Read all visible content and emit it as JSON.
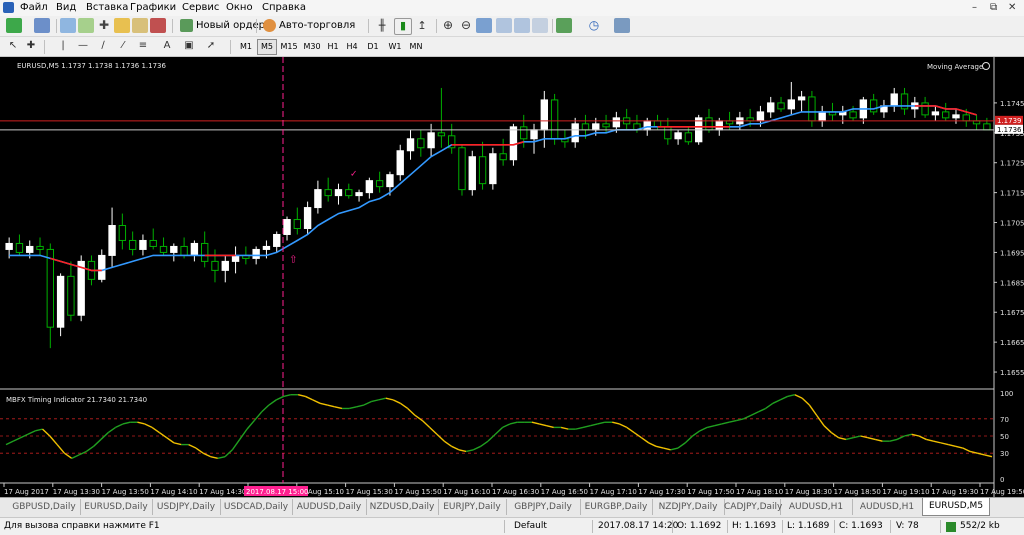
{
  "menu": [
    "Файл",
    "Вид",
    "Вставка",
    "Графики",
    "Сервис",
    "Окно",
    "Справка"
  ],
  "toolbar": {
    "new_order": "Новый ордер",
    "auto_trading": "Авто-торговля"
  },
  "timeframes": [
    "M1",
    "M5",
    "M15",
    "M30",
    "H1",
    "H4",
    "D1",
    "W1",
    "MN"
  ],
  "active_timeframe": "M5",
  "chart": {
    "header": "EURUSD,M5  1.1737 1.1738 1.1736 1.1736",
    "indicator_name": "Moving Average",
    "bid_label": "1.1736",
    "ask_label": "1.1739",
    "price_ticks": [
      "1.1745",
      "1.1735",
      "1.1725",
      "1.1715",
      "1.1705",
      "1.1695",
      "1.1685",
      "1.1675",
      "1.1665",
      "1.1655"
    ],
    "osc_header": "MBFX Timing Indicator 21.7340 21.7340",
    "osc_ticks": [
      "100",
      "70",
      "50",
      "30",
      "0"
    ],
    "time_ticks": [
      "17 Aug 2017",
      "17 Aug 13:30",
      "17 Aug 13:50",
      "17 Aug 14:10",
      "17 Aug 14:30",
      "2017.08.17 15:00",
      "17 Aug 15:10",
      "17 Aug 15:30",
      "17 Aug 15:50",
      "17 Aug 16:10",
      "17 Aug 16:30",
      "17 Aug 16:50",
      "17 Aug 17:10",
      "17 Aug 17:30",
      "17 Aug 17:50",
      "17 Aug 18:10",
      "17 Aug 18:30",
      "17 Aug 18:50",
      "17 Aug 19:10",
      "17 Aug 19:30",
      "17 Aug 19:50"
    ],
    "colors": {
      "bg": "#000000",
      "bull": "#ffffff",
      "bear": "#00b000",
      "ma_up": "#3399ff",
      "ma_down": "#ff2020",
      "osc_up": "#20a020",
      "osc_down": "#f0c000",
      "crosshair": "#ff2090"
    }
  },
  "chart_data": {
    "type": "candlestick",
    "symbol": "EURUSD",
    "timeframe": "M5",
    "ylim": [
      1.165,
      1.1755
    ],
    "candles": [
      {
        "o": 1.1696,
        "h": 1.17,
        "l": 1.1693,
        "c": 1.1698
      },
      {
        "o": 1.1698,
        "h": 1.1701,
        "l": 1.1694,
        "c": 1.1695
      },
      {
        "o": 1.1695,
        "h": 1.1699,
        "l": 1.1693,
        "c": 1.1697
      },
      {
        "o": 1.1697,
        "h": 1.17,
        "l": 1.1694,
        "c": 1.1696
      },
      {
        "o": 1.1696,
        "h": 1.1698,
        "l": 1.1663,
        "c": 1.167
      },
      {
        "o": 1.167,
        "h": 1.1688,
        "l": 1.1667,
        "c": 1.1687
      },
      {
        "o": 1.1687,
        "h": 1.1692,
        "l": 1.1672,
        "c": 1.1674
      },
      {
        "o": 1.1674,
        "h": 1.1694,
        "l": 1.1672,
        "c": 1.1692
      },
      {
        "o": 1.1692,
        "h": 1.1694,
        "l": 1.1684,
        "c": 1.1686
      },
      {
        "o": 1.1686,
        "h": 1.1696,
        "l": 1.1685,
        "c": 1.1694
      },
      {
        "o": 1.1694,
        "h": 1.171,
        "l": 1.169,
        "c": 1.1704
      },
      {
        "o": 1.1704,
        "h": 1.1708,
        "l": 1.1696,
        "c": 1.1699
      },
      {
        "o": 1.1699,
        "h": 1.1702,
        "l": 1.1694,
        "c": 1.1696
      },
      {
        "o": 1.1696,
        "h": 1.1701,
        "l": 1.1694,
        "c": 1.1699
      },
      {
        "o": 1.1699,
        "h": 1.1703,
        "l": 1.1696,
        "c": 1.1697
      },
      {
        "o": 1.1697,
        "h": 1.17,
        "l": 1.1694,
        "c": 1.1695
      },
      {
        "o": 1.1695,
        "h": 1.1698,
        "l": 1.1692,
        "c": 1.1697
      },
      {
        "o": 1.1697,
        "h": 1.17,
        "l": 1.1693,
        "c": 1.1694
      },
      {
        "o": 1.1694,
        "h": 1.1699,
        "l": 1.1692,
        "c": 1.1698
      },
      {
        "o": 1.1698,
        "h": 1.1702,
        "l": 1.169,
        "c": 1.1692
      },
      {
        "o": 1.1692,
        "h": 1.1696,
        "l": 1.1685,
        "c": 1.1689
      },
      {
        "o": 1.1689,
        "h": 1.1694,
        "l": 1.1685,
        "c": 1.1692
      },
      {
        "o": 1.1692,
        "h": 1.1697,
        "l": 1.1688,
        "c": 1.1694
      },
      {
        "o": 1.1694,
        "h": 1.1697,
        "l": 1.1691,
        "c": 1.1693
      },
      {
        "o": 1.1693,
        "h": 1.1697,
        "l": 1.1691,
        "c": 1.1696
      },
      {
        "o": 1.1696,
        "h": 1.1699,
        "l": 1.1693,
        "c": 1.1697
      },
      {
        "o": 1.1697,
        "h": 1.1702,
        "l": 1.1695,
        "c": 1.1701
      },
      {
        "o": 1.1701,
        "h": 1.1707,
        "l": 1.1699,
        "c": 1.1706
      },
      {
        "o": 1.1706,
        "h": 1.171,
        "l": 1.1701,
        "c": 1.1703
      },
      {
        "o": 1.1703,
        "h": 1.1712,
        "l": 1.1701,
        "c": 1.171
      },
      {
        "o": 1.171,
        "h": 1.1719,
        "l": 1.1708,
        "c": 1.1716
      },
      {
        "o": 1.1716,
        "h": 1.172,
        "l": 1.1712,
        "c": 1.1714
      },
      {
        "o": 1.1714,
        "h": 1.1718,
        "l": 1.1711,
        "c": 1.1716
      },
      {
        "o": 1.1716,
        "h": 1.1718,
        "l": 1.1713,
        "c": 1.1714
      },
      {
        "o": 1.1714,
        "h": 1.1716,
        "l": 1.1712,
        "c": 1.1715
      },
      {
        "o": 1.1715,
        "h": 1.172,
        "l": 1.1713,
        "c": 1.1719
      },
      {
        "o": 1.1719,
        "h": 1.1722,
        "l": 1.1715,
        "c": 1.1717
      },
      {
        "o": 1.1717,
        "h": 1.1722,
        "l": 1.1714,
        "c": 1.1721
      },
      {
        "o": 1.1721,
        "h": 1.1731,
        "l": 1.1719,
        "c": 1.1729
      },
      {
        "o": 1.1729,
        "h": 1.1736,
        "l": 1.1726,
        "c": 1.1733
      },
      {
        "o": 1.1733,
        "h": 1.1736,
        "l": 1.1727,
        "c": 1.173
      },
      {
        "o": 1.173,
        "h": 1.1738,
        "l": 1.1727,
        "c": 1.1735
      },
      {
        "o": 1.1735,
        "h": 1.175,
        "l": 1.173,
        "c": 1.1734
      },
      {
        "o": 1.1734,
        "h": 1.1738,
        "l": 1.1728,
        "c": 1.173
      },
      {
        "o": 1.173,
        "h": 1.1731,
        "l": 1.1714,
        "c": 1.1716
      },
      {
        "o": 1.1716,
        "h": 1.1729,
        "l": 1.1714,
        "c": 1.1727
      },
      {
        "o": 1.1727,
        "h": 1.1732,
        "l": 1.1716,
        "c": 1.1718
      },
      {
        "o": 1.1718,
        "h": 1.173,
        "l": 1.1716,
        "c": 1.1728
      },
      {
        "o": 1.1728,
        "h": 1.1733,
        "l": 1.1724,
        "c": 1.1726
      },
      {
        "o": 1.1726,
        "h": 1.1738,
        "l": 1.1724,
        "c": 1.1737
      },
      {
        "o": 1.1737,
        "h": 1.1741,
        "l": 1.173,
        "c": 1.1733
      },
      {
        "o": 1.1733,
        "h": 1.1738,
        "l": 1.1728,
        "c": 1.1736
      },
      {
        "o": 1.1736,
        "h": 1.1749,
        "l": 1.173,
        "c": 1.1746
      },
      {
        "o": 1.1746,
        "h": 1.1748,
        "l": 1.1731,
        "c": 1.1733
      },
      {
        "o": 1.1733,
        "h": 1.1736,
        "l": 1.173,
        "c": 1.1732
      },
      {
        "o": 1.1732,
        "h": 1.174,
        "l": 1.173,
        "c": 1.1738
      },
      {
        "o": 1.1738,
        "h": 1.1741,
        "l": 1.1733,
        "c": 1.1736
      },
      {
        "o": 1.1736,
        "h": 1.174,
        "l": 1.1734,
        "c": 1.1738
      },
      {
        "o": 1.1738,
        "h": 1.1741,
        "l": 1.1735,
        "c": 1.1737
      },
      {
        "o": 1.1737,
        "h": 1.1742,
        "l": 1.1735,
        "c": 1.174
      },
      {
        "o": 1.174,
        "h": 1.1743,
        "l": 1.1736,
        "c": 1.1738
      },
      {
        "o": 1.1738,
        "h": 1.1741,
        "l": 1.1735,
        "c": 1.1736
      },
      {
        "o": 1.1736,
        "h": 1.174,
        "l": 1.1734,
        "c": 1.1739
      },
      {
        "o": 1.1739,
        "h": 1.1741,
        "l": 1.1736,
        "c": 1.1737
      },
      {
        "o": 1.1737,
        "h": 1.174,
        "l": 1.1731,
        "c": 1.1733
      },
      {
        "o": 1.1733,
        "h": 1.1736,
        "l": 1.1731,
        "c": 1.1735
      },
      {
        "o": 1.1735,
        "h": 1.1737,
        "l": 1.1731,
        "c": 1.1732
      },
      {
        "o": 1.1732,
        "h": 1.1741,
        "l": 1.1731,
        "c": 1.174
      },
      {
        "o": 1.174,
        "h": 1.1743,
        "l": 1.1735,
        "c": 1.1736
      },
      {
        "o": 1.1736,
        "h": 1.174,
        "l": 1.1734,
        "c": 1.1739
      },
      {
        "o": 1.1739,
        "h": 1.1742,
        "l": 1.1736,
        "c": 1.1738
      },
      {
        "o": 1.1738,
        "h": 1.1742,
        "l": 1.1736,
        "c": 1.174
      },
      {
        "o": 1.174,
        "h": 1.1743,
        "l": 1.1737,
        "c": 1.1739
      },
      {
        "o": 1.1739,
        "h": 1.1744,
        "l": 1.1737,
        "c": 1.1742
      },
      {
        "o": 1.1742,
        "h": 1.1747,
        "l": 1.174,
        "c": 1.1745
      },
      {
        "o": 1.1745,
        "h": 1.1747,
        "l": 1.1742,
        "c": 1.1743
      },
      {
        "o": 1.1743,
        "h": 1.1752,
        "l": 1.1741,
        "c": 1.1746
      },
      {
        "o": 1.1746,
        "h": 1.1749,
        "l": 1.1742,
        "c": 1.1747
      },
      {
        "o": 1.1747,
        "h": 1.1749,
        "l": 1.1737,
        "c": 1.1739
      },
      {
        "o": 1.1739,
        "h": 1.1744,
        "l": 1.1737,
        "c": 1.1742
      },
      {
        "o": 1.1742,
        "h": 1.1745,
        "l": 1.1739,
        "c": 1.1741
      },
      {
        "o": 1.1741,
        "h": 1.1744,
        "l": 1.1738,
        "c": 1.1742
      },
      {
        "o": 1.1742,
        "h": 1.1744,
        "l": 1.1739,
        "c": 1.174
      },
      {
        "o": 1.174,
        "h": 1.1747,
        "l": 1.1738,
        "c": 1.1746
      },
      {
        "o": 1.1746,
        "h": 1.1748,
        "l": 1.1741,
        "c": 1.1742
      },
      {
        "o": 1.1742,
        "h": 1.1746,
        "l": 1.174,
        "c": 1.1744
      },
      {
        "o": 1.1744,
        "h": 1.175,
        "l": 1.1742,
        "c": 1.1748
      },
      {
        "o": 1.1748,
        "h": 1.175,
        "l": 1.1741,
        "c": 1.1743
      },
      {
        "o": 1.1743,
        "h": 1.1747,
        "l": 1.174,
        "c": 1.1745
      },
      {
        "o": 1.1745,
        "h": 1.1747,
        "l": 1.174,
        "c": 1.1741
      },
      {
        "o": 1.1741,
        "h": 1.1744,
        "l": 1.1739,
        "c": 1.1742
      },
      {
        "o": 1.1742,
        "h": 1.1745,
        "l": 1.1739,
        "c": 1.174
      },
      {
        "o": 1.174,
        "h": 1.1743,
        "l": 1.1738,
        "c": 1.1741
      },
      {
        "o": 1.1741,
        "h": 1.1743,
        "l": 1.1737,
        "c": 1.1739
      },
      {
        "o": 1.1739,
        "h": 1.1741,
        "l": 1.1736,
        "c": 1.1738
      },
      {
        "o": 1.1738,
        "h": 1.174,
        "l": 1.1736,
        "c": 1.1736
      }
    ],
    "ma": [
      1.1694,
      1.1694,
      1.1694,
      1.1694,
      1.1693,
      1.1692,
      1.1691,
      1.169,
      1.1689,
      1.1689,
      1.169,
      1.1691,
      1.1692,
      1.1693,
      1.1694,
      1.1694,
      1.1694,
      1.1694,
      1.1694,
      1.1694,
      1.1694,
      1.1694,
      1.1694,
      1.1694,
      1.1694,
      1.1694,
      1.1695,
      1.1697,
      1.1699,
      1.1701,
      1.1704,
      1.1706,
      1.1708,
      1.1709,
      1.171,
      1.1712,
      1.1713,
      1.1715,
      1.1718,
      1.1721,
      1.1724,
      1.1727,
      1.1729,
      1.1731,
      1.1731,
      1.1731,
      1.1731,
      1.1731,
      1.1731,
      1.1731,
      1.1732,
      1.1732,
      1.1733,
      1.1733,
      1.1733,
      1.1734,
      1.1734,
      1.1735,
      1.1735,
      1.1736,
      1.1736,
      1.1736,
      1.1737,
      1.1737,
      1.1737,
      1.1737,
      1.1737,
      1.1737,
      1.1737,
      1.1737,
      1.1737,
      1.1737,
      1.1738,
      1.1738,
      1.1739,
      1.174,
      1.1741,
      1.1742,
      1.1742,
      1.1742,
      1.1742,
      1.1742,
      1.1743,
      1.1743,
      1.1743,
      1.1744,
      1.1744,
      1.1744,
      1.1744,
      1.1744,
      1.1744,
      1.1743,
      1.1743,
      1.1742,
      1.1741
    ],
    "ma_down_ranges": [
      [
        4,
        9
      ],
      [
        19,
        22
      ],
      [
        43,
        50
      ],
      [
        63,
        70
      ],
      [
        88,
        94
      ]
    ],
    "osc_ylim": [
      0,
      100
    ],
    "oscillator": [
      40,
      44,
      48,
      52,
      56,
      58,
      50,
      40,
      30,
      24,
      28,
      32,
      38,
      46,
      54,
      60,
      64,
      66,
      66,
      64,
      60,
      54,
      48,
      42,
      40,
      40,
      36,
      30,
      26,
      24,
      26,
      34,
      46,
      58,
      68,
      78,
      86,
      92,
      96,
      98,
      98,
      96,
      92,
      88,
      86,
      84,
      82,
      82,
      84,
      86,
      90,
      92,
      94,
      92,
      88,
      82,
      74,
      68,
      60,
      52,
      44,
      38,
      34,
      32,
      34,
      38,
      44,
      52,
      60,
      64,
      66,
      66,
      66,
      64,
      62,
      60,
      60,
      58,
      58,
      60,
      62,
      64,
      66,
      66,
      64,
      60,
      54,
      48,
      42,
      38,
      36,
      34,
      36,
      42,
      50,
      56,
      60,
      62,
      64,
      66,
      68,
      70,
      74,
      78,
      82,
      88,
      92,
      96,
      98,
      94,
      86,
      74,
      62,
      54,
      48,
      46,
      48,
      50,
      48,
      46,
      44,
      44,
      46,
      50,
      52,
      50,
      46,
      44,
      42,
      40,
      38,
      36,
      32,
      30,
      28,
      26
    ]
  },
  "tabs": [
    "GBPUSD,Daily",
    "EURUSD,Daily",
    "USDJPY,Daily",
    "USDCAD,Daily",
    "AUDUSD,Daily",
    "NZDUSD,Daily",
    "EURJPY,Daily",
    "GBPJPY,Daily",
    "EURGBP,Daily",
    "NZDJPY,Daily",
    "CADJPY,Daily",
    "AUDUSD,H1",
    "AUDUSD,H1",
    "EURUSD,M5"
  ],
  "active_tab": "EURUSD,M5",
  "status": {
    "help": "Для вызова справки нажмите F1",
    "profile": "Default",
    "datetime": "2017.08.17 14:20",
    "open": "O: 1.1692",
    "high": "H: 1.1693",
    "low": "L: 1.1689",
    "close": "C: 1.1693",
    "volume": "V: 78",
    "traffic": "552/2 kb"
  }
}
